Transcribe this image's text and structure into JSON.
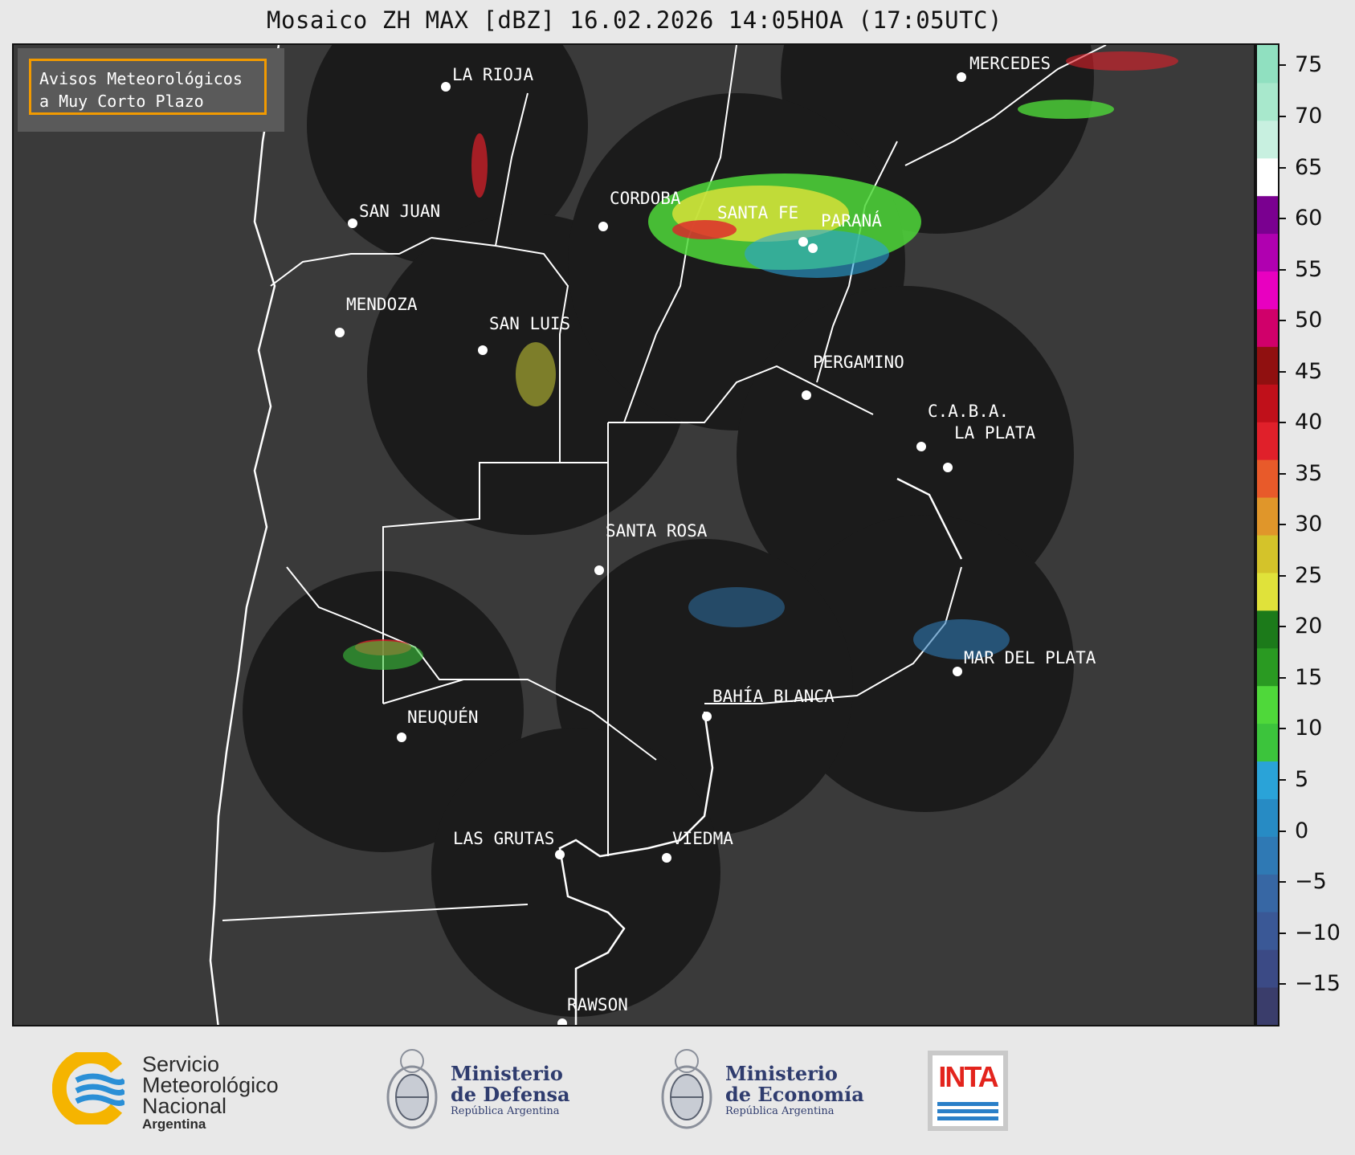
{
  "title": "Mosaico ZH MAX [dBZ] 16.02.2026 14:05HOA (17:05UTC)",
  "notice": {
    "line1": "Avisos Meteorológicos",
    "line2": "a Muy Corto Plazo"
  },
  "cities": [
    {
      "name": "LA RIOJA"
    },
    {
      "name": "MERCEDES"
    },
    {
      "name": "SAN JUAN"
    },
    {
      "name": "CORDOBA"
    },
    {
      "name": "SANTA FE"
    },
    {
      "name": "PARANÁ"
    },
    {
      "name": "MENDOZA"
    },
    {
      "name": "SAN LUIS"
    },
    {
      "name": "PERGAMINO"
    },
    {
      "name": "C.A.B.A."
    },
    {
      "name": "LA PLATA"
    },
    {
      "name": "SANTA ROSA"
    },
    {
      "name": "MAR DEL PLATA"
    },
    {
      "name": "BAHÍA BLANCA"
    },
    {
      "name": "NEUQUÉN"
    },
    {
      "name": "LAS GRUTAS"
    },
    {
      "name": "VIEDMA"
    },
    {
      "name": "RAWSON"
    }
  ],
  "colorbar": {
    "unit": "dBZ",
    "min": -19,
    "max": 77,
    "ticks": [
      "75",
      "70",
      "65",
      "60",
      "55",
      "50",
      "45",
      "40",
      "35",
      "30",
      "25",
      "20",
      "15",
      "10",
      "5",
      "0",
      "−5",
      "−10",
      "−15"
    ],
    "tick_values": [
      75,
      70,
      65,
      60,
      55,
      50,
      45,
      40,
      35,
      30,
      25,
      20,
      15,
      10,
      5,
      0,
      -5,
      -10,
      -15
    ],
    "colors": [
      "#3a3d6b",
      "#3b4a85",
      "#3a5896",
      "#3767a4",
      "#2f79b4",
      "#278bc4",
      "#2aa3d8",
      "#3cc43c",
      "#4fd83a",
      "#2a9a22",
      "#1c7a1a",
      "#e0e23a",
      "#d4c32a",
      "#e0962a",
      "#e85a2a",
      "#e0202a",
      "#c0101a",
      "#901010",
      "#d0006a",
      "#e800c0",
      "#b000b0",
      "#7a0090",
      "#ffffff",
      "#c8f0e0",
      "#a8e8cc",
      "#90e0c0"
    ]
  },
  "logos": {
    "smn": {
      "line1": "Servicio",
      "line2": "Meteorológico",
      "line3": "Nacional",
      "line4": "Argentina"
    },
    "defensa": {
      "line1": "Ministerio",
      "line2": "de Defensa",
      "line3": "República Argentina"
    },
    "economia": {
      "line1": "Ministerio",
      "line2": "de Economía",
      "line3": "República Argentina"
    },
    "inta": {
      "label": "INTA"
    }
  }
}
